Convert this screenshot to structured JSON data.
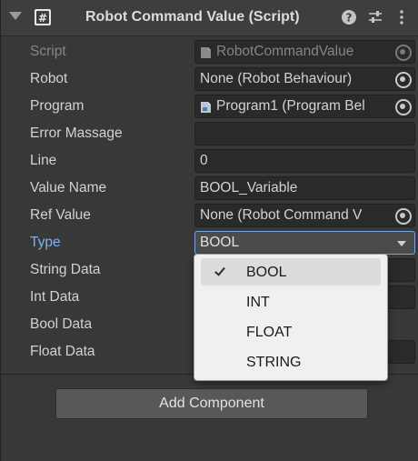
{
  "component": {
    "title": "Robot Command Value (Script)"
  },
  "properties": [
    {
      "label": "Script",
      "value": "RobotCommandValue",
      "kind": "object",
      "disabled": true
    },
    {
      "label": "Robot",
      "value": "None (Robot Behaviour)",
      "kind": "object-none"
    },
    {
      "label": "Program",
      "value": "Program1 (Program Bel",
      "kind": "object"
    },
    {
      "label": "Error Massage",
      "value": "",
      "kind": "text"
    },
    {
      "label": "Line",
      "value": "0",
      "kind": "text"
    },
    {
      "label": "Value Name",
      "value": "BOOL_Variable",
      "kind": "text"
    },
    {
      "label": "Ref Value",
      "value": "None (Robot Command V",
      "kind": "object-none"
    },
    {
      "label": "Type",
      "value": "BOOL",
      "kind": "enum"
    },
    {
      "label": "String Data",
      "value": "",
      "kind": "text"
    },
    {
      "label": "Int Data",
      "value": "",
      "kind": "text"
    },
    {
      "label": "Bool Data",
      "value": "",
      "kind": "bool"
    },
    {
      "label": "Float Data",
      "value": "",
      "kind": "text"
    }
  ],
  "type_dropdown": {
    "options": [
      "BOOL",
      "INT",
      "FLOAT",
      "STRING"
    ],
    "selected": "BOOL"
  },
  "add_component": {
    "label": "Add Component"
  },
  "colors": {
    "background": "#383838",
    "field": "#2a2a2a",
    "active_label": "#7cb2ef",
    "popup": "#f0f0f0"
  }
}
